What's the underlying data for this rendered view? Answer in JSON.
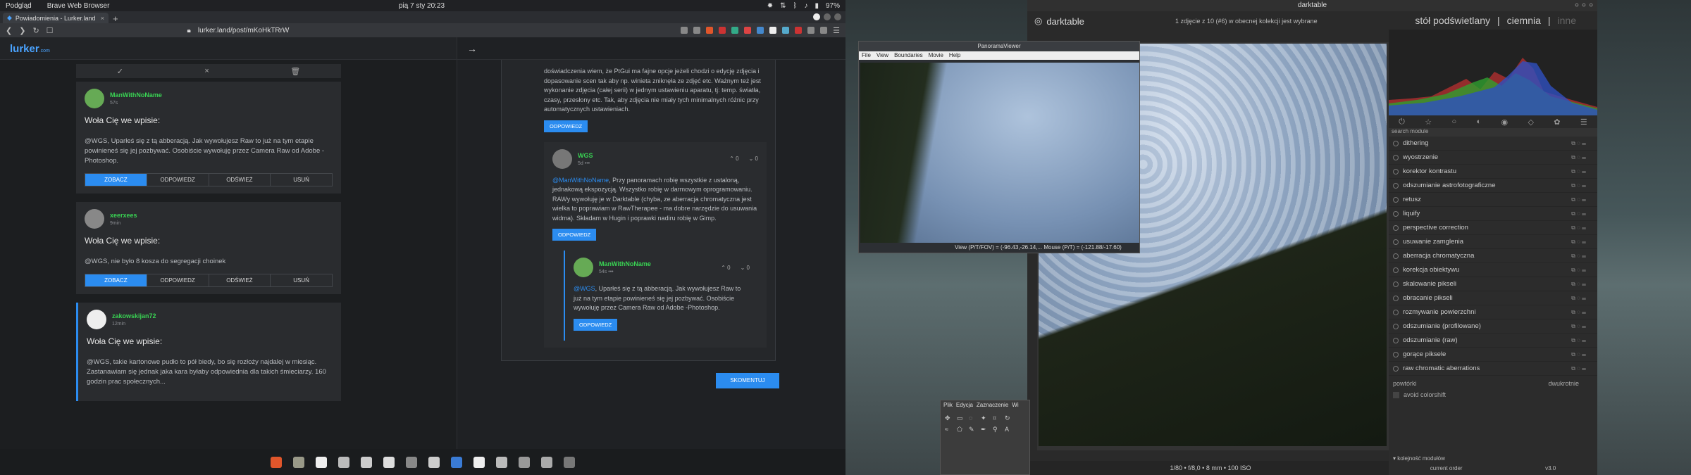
{
  "system": {
    "app": "Podgląd",
    "browser_app": "Brave Web Browser",
    "clock": "pią 7 sty 20:23",
    "battery": "97%"
  },
  "browser": {
    "tab_title": "Powiadomienia - Lurker.land",
    "url": "lurker.land/post/mKoHkTRrW",
    "logo": "lurker",
    "logo_suffix": ".com"
  },
  "feed": [
    {
      "user": "ManWithNoName",
      "time": "57s",
      "title": "Woła Cię we wpisie:",
      "body": "@WGS, Uparłeś się z tą abberacją. Jak wywołujesz Raw to już na tym etapie powinieneś się jej pozbywać. Osobiście wywołuję przez Camera Raw od Adobe -Photoshop.",
      "buttons": [
        "ZOBACZ",
        "ODPOWIEDZ",
        "ODŚWIEŻ",
        "USUŃ"
      ]
    },
    {
      "user": "xeerxees",
      "time": "9min",
      "title": "Woła Cię we wpisie:",
      "body": "@WGS, nie było 8 kosza do segregacji choinek",
      "buttons": [
        "ZOBACZ",
        "ODPOWIEDZ",
        "ODŚWIEŻ",
        "USUŃ"
      ]
    },
    {
      "user": "zakowskijan72",
      "time": "12min",
      "title": "Woła Cię we wpisie:",
      "body": "@WGS, takie kartonowe pudło to pół biedy, bo się rozłoży najdalej w miesiąc. Zastanawiam się jednak jaka kara byłaby odpowiednia dla takich śmieciarzy. 160 godzin prac społecznych..."
    }
  ],
  "thread": {
    "top_comment": "doświadczenia wiem, że PtGui ma fajne opcje jeżeli chodzi o edycję zdjęcia i dopasowanie scen tak aby np. winieta zniknęła ze zdjęć etc. Ważnym też jest wykonanie zdjęcia (całej serii) w jednym ustawieniu aparatu, tj: temp. światła, czasy, przesłony etc. Tak, aby zdjęcia nie miały tych minimalnych różnic przy automatycznych ustawieniach.",
    "reply_label": "ODPOWIEDZ",
    "wgs": {
      "user": "WGS",
      "time": "5d",
      "up": "0",
      "down": "0",
      "mention": "@ManWithNoName",
      "text": ", Przy panoramach robię wszystkie z ustaloną, jednakową ekspozycją. Wszystko robię w darmowym oprogramowaniu. RAWy wywołuję je w Darktable (chyba, ze aberracja chromatyczna jest wielka to poprawiam w RawTherapee - ma dobre narzędzie do usuwania widma). Składam w Hugin i poprawki nadiru robię w Gimp."
    },
    "mwn": {
      "user": "ManWithNoName",
      "time": "54s",
      "up": "0",
      "down": "0",
      "mention": "@WGS",
      "text": ", Uparłeś się z tą abberacją. Jak wywołujesz Raw to już na tym etapie powinieneś się jej pozbywać. Osobiście wywołuję przez Camera Raw od Adobe -Photoshop."
    },
    "submit": "SKOMENTUJ"
  },
  "darktable": {
    "title": "darktable",
    "logo": "darktable",
    "info": "1 zdjęcie z 10 (#6) w obecnej kolekcji jest wybrane",
    "views": [
      "stół podświetlany",
      "ciemnia",
      "inne"
    ],
    "search": "search module",
    "modules": [
      "dithering",
      "wyostrzenie",
      "korektor kontrastu",
      "odszumianie astrofotograficzne",
      "retusz",
      "liquify",
      "perspective correction",
      "usuwanie zamglenia",
      "aberracja chromatyczna",
      "korekcja obiektywu",
      "skalowanie pikseli",
      "obracanie pikseli",
      "rozmywanie powierzchni",
      "odszumianie (profilowane)",
      "odszumianie (raw)",
      "gorące piksele",
      "raw chromatic aberrations"
    ],
    "presets_label": "powtórki",
    "presets_value": "dwukrotnie",
    "avoid": "avoid colorshift",
    "order": "kolejność modułów",
    "current_order": "current order",
    "version": "v3.0",
    "exif": "1/80 • f/8,0 • 8 mm • 100 ISO"
  },
  "panorama": {
    "title": "PanoramaViewer",
    "menu": [
      "File",
      "View",
      "Boundaries",
      "Movie",
      "Help"
    ],
    "status": "View (P/T/FOV) = (-96.43,-26.14,...   Mouse (P/T) = (-121.88/-17.60)"
  },
  "gimp": {
    "menu": [
      "Plik",
      "Edycja",
      "Zaznaczenie",
      "Wi"
    ]
  }
}
